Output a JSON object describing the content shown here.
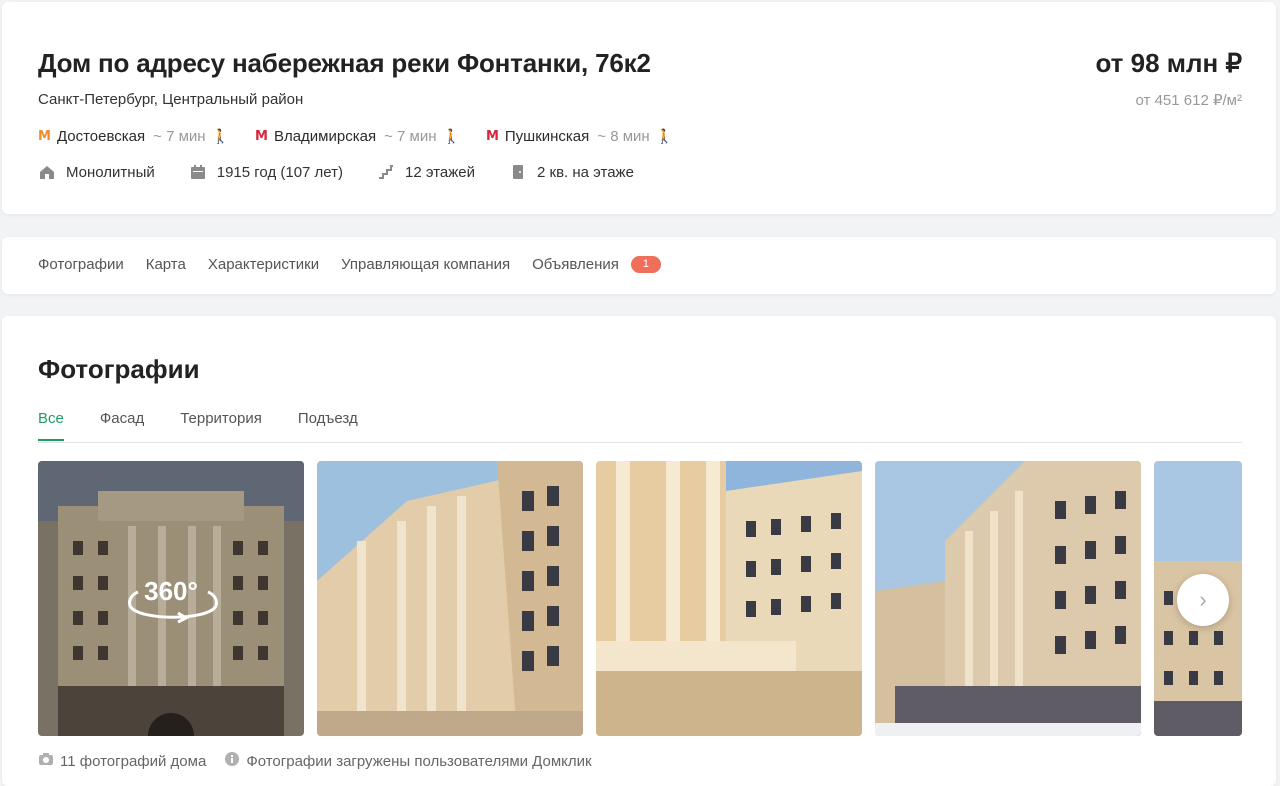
{
  "header": {
    "title": "Дом по адресу набережная реки Фонтанки, 76к2",
    "subtitle": "Санкт-Петербург, Центральный район",
    "price": "от 98 млн ₽",
    "price_per_sqm": "от 451 612 ₽/м²",
    "metro": [
      {
        "name": "Достоевская",
        "time": "~ 7 мин",
        "color": "#f08c2a"
      },
      {
        "name": "Владимирская",
        "time": "~ 7 мин",
        "color": "#d6283a"
      },
      {
        "name": "Пушкинская",
        "time": "~ 8 мин",
        "color": "#d6283a"
      }
    ],
    "facts": {
      "material": "Монолитный",
      "year": "1915 год (107 лет)",
      "floors": "12 этажей",
      "flats_per_floor": "2 кв. на этаже"
    }
  },
  "nav": {
    "tabs": [
      "Фотографии",
      "Карта",
      "Характеристики",
      "Управляющая компания",
      "Объявления"
    ],
    "ads_count": "1"
  },
  "photos": {
    "title": "Фотографии",
    "tabs": [
      "Все",
      "Фасад",
      "Территория",
      "Подъезд"
    ],
    "active_tab": "Все",
    "pano_label": "360°",
    "count_text": "11 фотографий дома",
    "source_text": "Фотографии загружены пользователями Домклик"
  },
  "colors": {
    "accent": "#1e9e63",
    "badge": "#ef6f5b",
    "metro_orange": "#f08c2a",
    "metro_red": "#d6283a"
  }
}
